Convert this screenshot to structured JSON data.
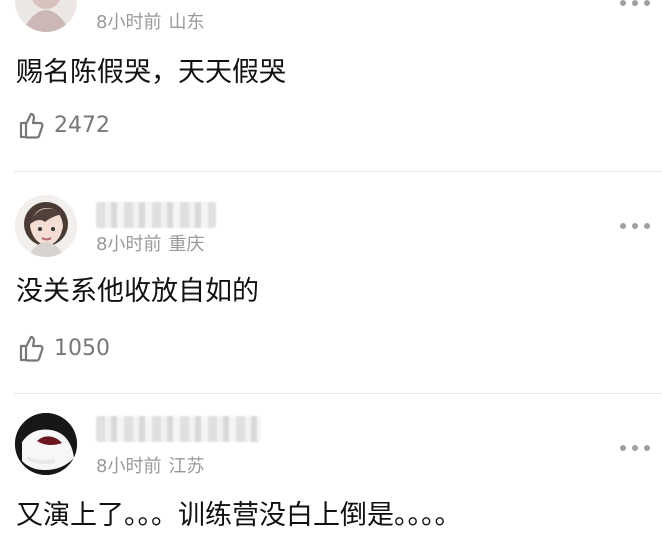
{
  "comments": [
    {
      "time": "8小时前",
      "location": "山东",
      "content": "赐名陈假哭，天天假哭",
      "likes": "2472",
      "avatar_icon": "blurred-profile-avatar-icon",
      "more_icon": "more-options-icon"
    },
    {
      "time": "8小时前",
      "location": "重庆",
      "content": "没关系他收放自如的",
      "likes": "1050",
      "avatar_icon": "cartoon-girl-avatar-icon",
      "more_icon": "more-options-icon"
    },
    {
      "time": "8小时前",
      "location": "江苏",
      "content": "又演上了。。。训练营没白上倒是。。。。",
      "avatar_icon": "blurred-white-figure-avatar-icon",
      "more_icon": "more-options-icon"
    }
  ],
  "colors": {
    "text": "#111111",
    "meta": "#9a9a9a",
    "icon": "#777777",
    "divider": "#e6e6e6"
  }
}
